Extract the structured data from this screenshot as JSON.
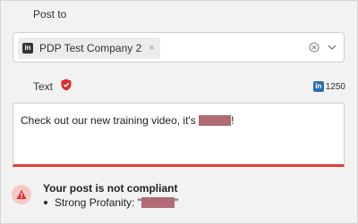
{
  "post_to": {
    "label": "Post to",
    "selected_chip": {
      "icon": "linkedin-icon",
      "icon_text": "in",
      "label": "PDP Test Company 2",
      "remove_glyph": "×"
    },
    "clear_icon": "clear-circle-icon",
    "dropdown_icon": "chevron-down-icon"
  },
  "text_field": {
    "label": "Text",
    "status_icon": "shield-check-icon",
    "counter": {
      "network_icon": "linkedin-icon",
      "icon_text": "in",
      "remaining": "1250"
    },
    "value_before": "Check out our new training video, it's ",
    "value_after": "!",
    "error_color": "#e0403a"
  },
  "compliance": {
    "icon": "warning-triangle-icon",
    "title": "Your post is not compliant",
    "issue_prefix": "Strong Profanity: \"",
    "issue_suffix": "\""
  }
}
